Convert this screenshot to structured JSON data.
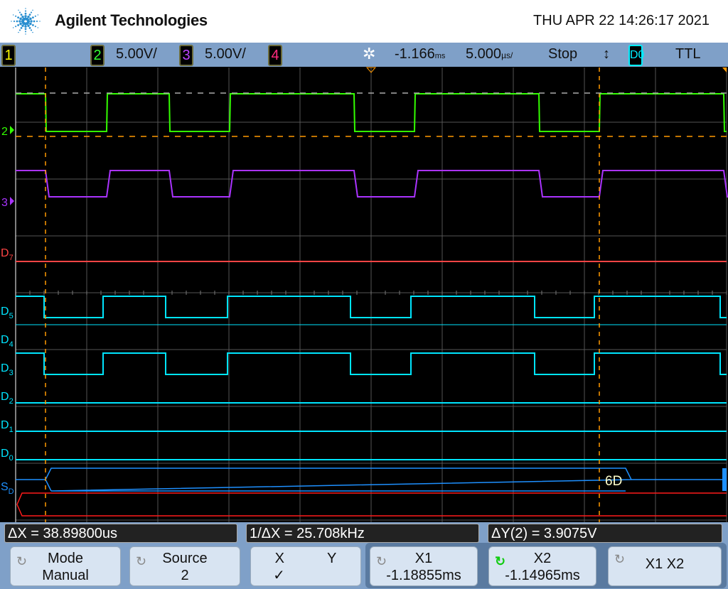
{
  "header": {
    "brand": "Agilent Technologies",
    "datetime": "THU APR 22 14:26:17 2021"
  },
  "status": {
    "ch1": "1",
    "ch2": "2",
    "ch2_scale": "5.00V/",
    "ch3": "3",
    "ch3_scale": "5.00V/",
    "ch4": "4",
    "delay": "-1.166",
    "delay_unit": "ms",
    "timebase": "5.000",
    "timebase_unit": "µs/",
    "run_state": "Stop",
    "trigger_slope_icon": "updown-arrow-icon",
    "digital_label": "D0",
    "threshold": "TTL"
  },
  "colors": {
    "ch1": "#ffff00",
    "ch2": "#33ff00",
    "ch3": "#aa33ff",
    "ch4": "#ff2a7f",
    "digital": "#00e5ff",
    "d7": "#ff4444",
    "cursor": "#ff9900",
    "serial": "#1e90ff"
  },
  "channel_labels": {
    "ch2": "2",
    "ch3": "3",
    "d7": "D7",
    "d5": "D5",
    "d4": "D4",
    "d3": "D3",
    "d2": "D2",
    "d1": "D1",
    "d0": "D0",
    "serial": "SD"
  },
  "decode": {
    "value": "6D"
  },
  "measurements": {
    "dx": "ΔX = 38.89800us",
    "inv_dx": "1/ΔX = 25.708kHz",
    "dy": "ΔY(2) = 3.9075V"
  },
  "softkeys": [
    {
      "title": "Mode",
      "value": "Manual"
    },
    {
      "title": "Source",
      "value": "2"
    },
    {
      "title": "X",
      "title2": "Y",
      "value": "✓"
    },
    {
      "title": "X1",
      "value": "-1.18855ms"
    },
    {
      "title": "X2",
      "value": "-1.14965ms"
    },
    {
      "title": "X1 X2",
      "value": ""
    }
  ]
}
